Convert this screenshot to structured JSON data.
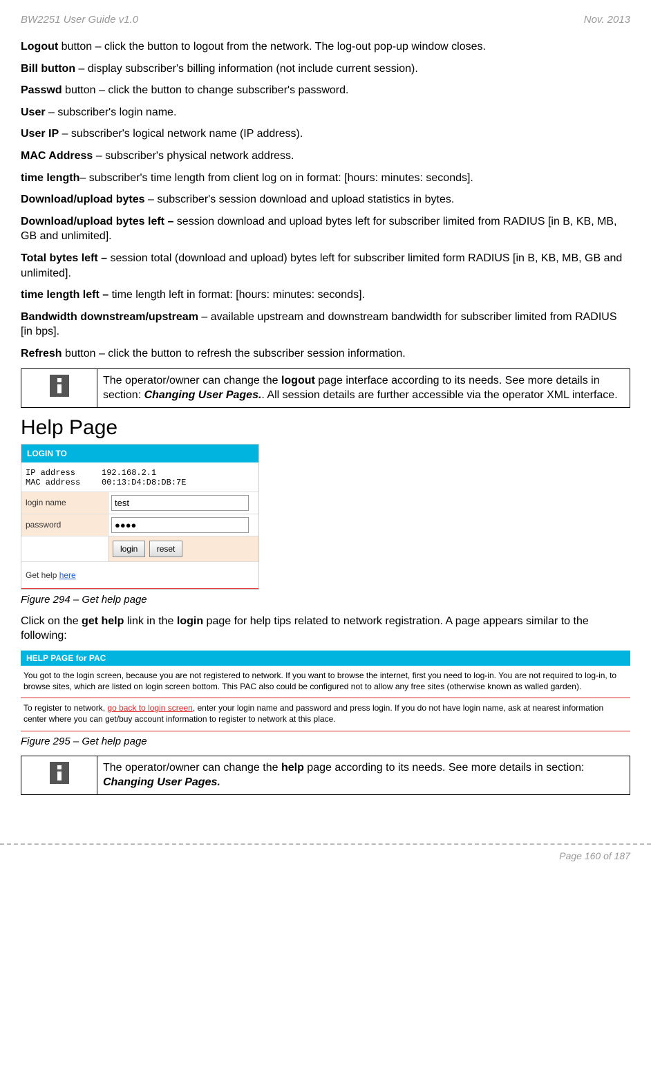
{
  "header": {
    "left": "BW2251 User Guide v1.0",
    "right": "Nov.  2013"
  },
  "defs": {
    "logout": {
      "term": "Logout",
      "post": " button – click the button to logout from the network. The log-out pop-up window closes."
    },
    "bill": {
      "term": "Bill button",
      "post": " – display subscriber's billing information (not include current session)."
    },
    "passwd": {
      "term": "Passwd",
      "post": " button – click the button to change subscriber's password."
    },
    "user": {
      "term": "User",
      "post": " – subscriber's login name."
    },
    "userip": {
      "term": "User IP",
      "post": " – subscriber's logical network name (IP address)."
    },
    "mac": {
      "term": "MAC Address",
      "post": " – subscriber's physical network address."
    },
    "timelen": {
      "term": "time length",
      "post": "– subscriber's time length from client log on in format: [hours: minutes: seconds]."
    },
    "dlul": {
      "term": "Download/upload bytes",
      "post": " – subscriber's session download and upload statistics in bytes."
    },
    "dlulleft": {
      "term": "Download/upload bytes left –",
      "post": " session download and upload bytes left for subscriber limited from RADIUS [in B, KB, MB, GB and unlimited]."
    },
    "totalleft": {
      "term": "Total bytes left –",
      "post": " session total (download and upload) bytes left for subscriber limited form RADIUS [in B, KB, MB, GB and unlimited]."
    },
    "timelenleft": {
      "term": "time length left –",
      "post": " time length left in format: [hours: minutes: seconds]."
    },
    "bw": {
      "term": "Bandwidth downstream/upstream",
      "post": " – available upstream and downstream bandwidth for subscriber limited from RADIUS [in bps]."
    },
    "refresh": {
      "term": "Refresh",
      "post": " button – click the button to refresh the subscriber session information."
    }
  },
  "info1": {
    "pre": "The operator/owner can change the ",
    "bold1": "logout",
    "mid1": " page interface according to its needs. See more details in section: ",
    "bolditalic": "Changing User Pages.",
    "post": ". All session details are further accessible via the operator XML interface."
  },
  "help_title": "Help Page",
  "login_panel": {
    "title": "LOGIN TO",
    "ip_label": "IP address",
    "ip_value": "192.168.2.1",
    "mac_label": "MAC address",
    "mac_value": "00:13:D4:D8:DB:7E",
    "login_name_label": "login name",
    "login_name_value": "test",
    "password_label": "password",
    "password_value": "●●●●",
    "login_btn": "login",
    "reset_btn": "reset",
    "gethelp_pre": "Get help ",
    "gethelp_link": "here"
  },
  "caption1": "Figure 294 – Get help page",
  "para1": {
    "pre": "Click on the ",
    "b1": "get help",
    "mid": " link in the ",
    "b2": "login",
    "post": " page for help tips related to network registration. A page appears similar to the following:"
  },
  "help_page": {
    "title": "HELP PAGE for PAC",
    "text1": "You got to the login screen, because you are not registered to network. If you want to browse the internet, first you need to log-in. You are not required to log-in, to browse sites, which are listed on login screen bottom. This PAC also could be configured not to allow any free sites (otherwise known as walled garden).",
    "text2_pre": "To register to network, ",
    "text2_link": "go back to login screen",
    "text2_post": ", enter your login name and password and press login. If you do not have login name, ask at nearest information center where you can get/buy account information to register to network at this place."
  },
  "caption2": "Figure 295 – Get help page",
  "info2": {
    "pre": "The operator/owner can change the ",
    "bold1": "help",
    "mid1": " page according to its needs. See more details in section: ",
    "bolditalic": "Changing User Pages."
  },
  "footer": "Page 160 of 187"
}
